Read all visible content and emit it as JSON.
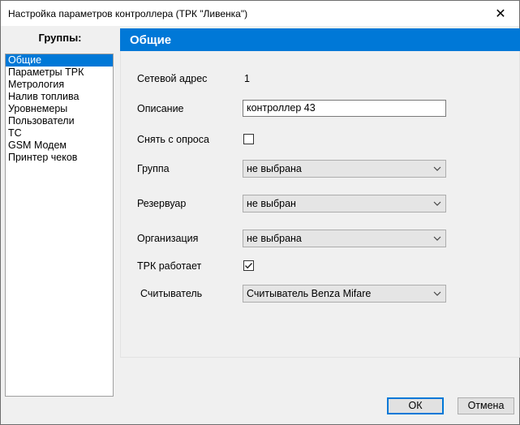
{
  "window": {
    "title": "Настройка параметров контроллера (ТРК \"Ливенка\")"
  },
  "groups": {
    "label": "Группы:",
    "items": [
      "Общие",
      "Параметры ТРК",
      "Метрология",
      "Налив топлива",
      "Уровнемеры",
      "Пользователи",
      "ТС",
      "GSM Модем",
      "Принтер чеков"
    ],
    "selected": "Общие"
  },
  "panel": {
    "header": "Общие"
  },
  "form": {
    "network_address_label": "Сетевой адрес",
    "network_address_value": "1",
    "description_label": "Описание",
    "description_value": "контроллер 43",
    "remove_from_poll_label": "Снять с опроса",
    "remove_from_poll_checked": false,
    "group_label": "Группа",
    "group_value": "не выбрана",
    "tank_label": "Резервуар",
    "tank_value": "не выбран",
    "organization_label": "Организация",
    "organization_value": "не выбрана",
    "trk_works_label": "ТРК работает",
    "trk_works_checked": true,
    "reader_label": "Считыватель",
    "reader_value": "Считыватель Benza Mifare"
  },
  "buttons": {
    "ok": "ОК",
    "cancel": "Отмена"
  },
  "colors": {
    "accent": "#0078d7",
    "background": "#f0f0f0"
  }
}
